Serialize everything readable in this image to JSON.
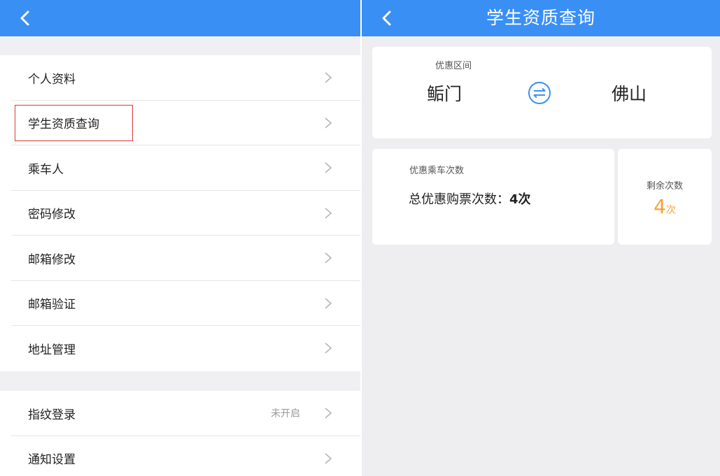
{
  "left": {
    "header": {
      "back_icon": "chevron-left-icon"
    },
    "settings_group_1": [
      {
        "label": "个人资料"
      },
      {
        "label": "学生资质查询"
      },
      {
        "label": "乘车人"
      },
      {
        "label": "密码修改"
      },
      {
        "label": "邮箱修改"
      },
      {
        "label": "邮箱验证"
      },
      {
        "label": "地址管理"
      }
    ],
    "settings_group_2": [
      {
        "label": "指纹登录",
        "status": "未开启"
      },
      {
        "label": "通知设置"
      }
    ],
    "highlighted_item": "学生资质查询"
  },
  "right": {
    "header": {
      "title": "学生资质查询",
      "back_icon": "chevron-left-icon"
    },
    "route_card": {
      "label": "优惠区间",
      "from": "鲘门",
      "to": "佛山",
      "swap_icon": "swap-icon"
    },
    "rides_card": {
      "label": "优惠乘车次数",
      "total_label": "总优惠购票次数：",
      "total_value": "4次"
    },
    "remaining_card": {
      "label": "剩余次数",
      "value": "4",
      "unit": "次"
    }
  },
  "colors": {
    "header_blue": "#3a8ff4",
    "accent_orange": "#f2a33a",
    "highlight_red": "#d93b3b"
  }
}
